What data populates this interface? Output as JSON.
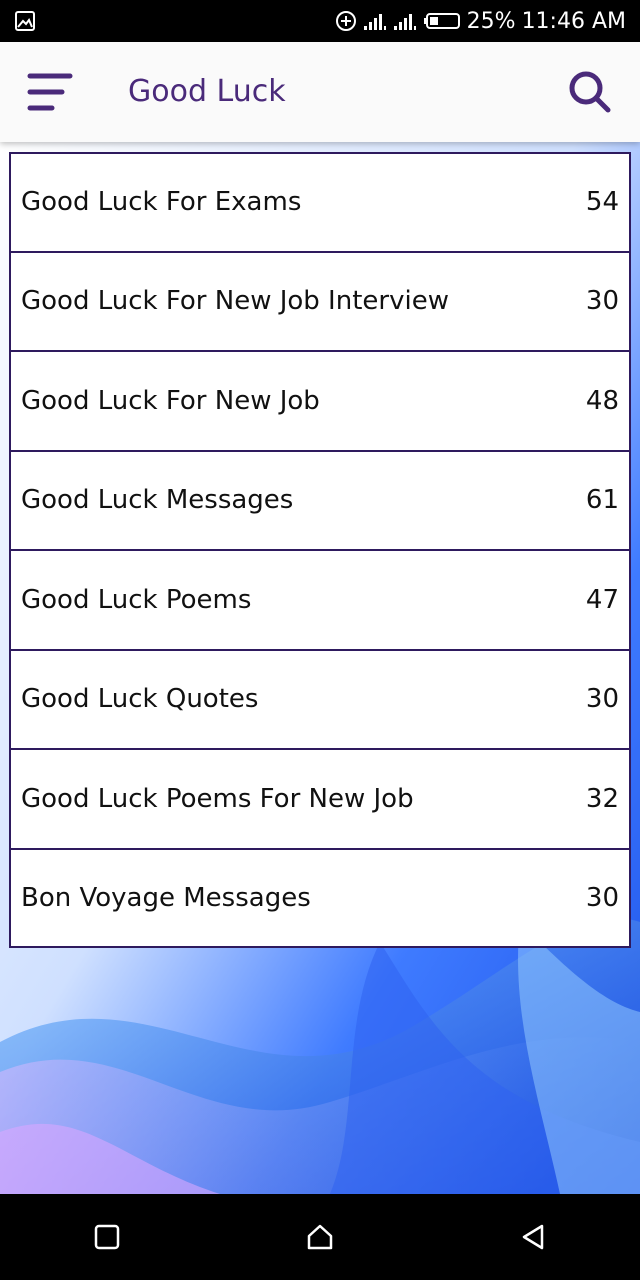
{
  "status_bar": {
    "battery": "25%",
    "time": "11:46 AM"
  },
  "app_bar": {
    "title": "Good Luck",
    "menu_icon": "menu-icon",
    "search_icon": "search-icon"
  },
  "categories": [
    {
      "label": "Good Luck For Exams",
      "count": "54"
    },
    {
      "label": "Good Luck For New Job Interview",
      "count": "30"
    },
    {
      "label": "Good Luck For New Job",
      "count": "48"
    },
    {
      "label": "Good Luck Messages",
      "count": "61"
    },
    {
      "label": "Good Luck Poems",
      "count": "47"
    },
    {
      "label": "Good Luck Quotes",
      "count": "30"
    },
    {
      "label": "Good Luck Poems For New Job",
      "count": "32"
    },
    {
      "label": "Bon Voyage Messages",
      "count": "30"
    }
  ],
  "nav_bar": {
    "recents_icon": "square-icon",
    "home_icon": "home-icon",
    "back_icon": "back-triangle-icon"
  },
  "colors": {
    "accent": "#4a2a7a",
    "border": "#2e1a5e"
  }
}
